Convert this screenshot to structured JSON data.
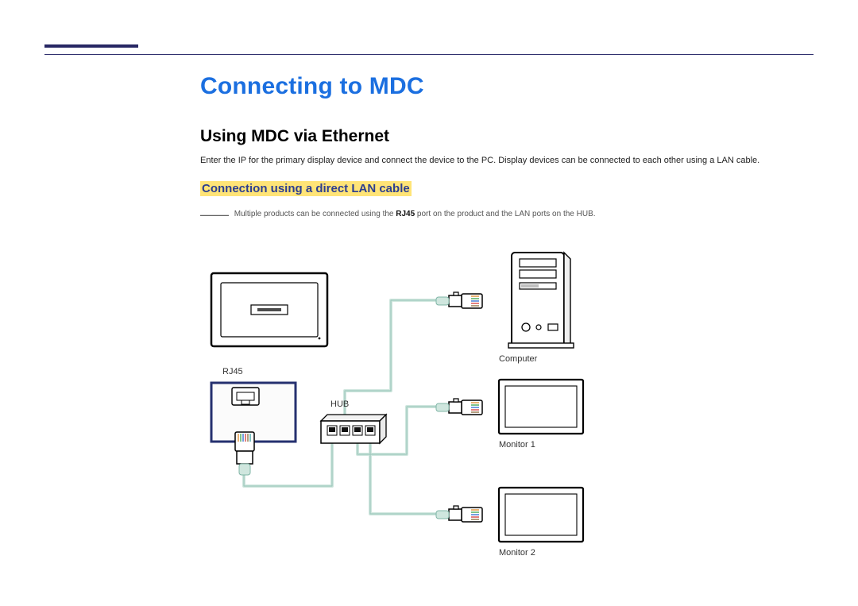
{
  "title": "Connecting to MDC",
  "section": "Using MDC via Ethernet",
  "intro": "Enter the IP for the primary display device and connect the device to the PC. Display devices can be connected to each other using a LAN cable.",
  "subsection": "Connection using a direct LAN cable",
  "note_prefix": "――",
  "note_text_a": "Multiple products can be connected using the ",
  "note_bold": "RJ45",
  "note_text_b": " port on the product and the LAN ports on the HUB.",
  "labels": {
    "rj45": "RJ45",
    "hub": "HUB",
    "computer": "Computer",
    "monitor1": "Monitor 1",
    "monitor2": "Monitor 2"
  }
}
